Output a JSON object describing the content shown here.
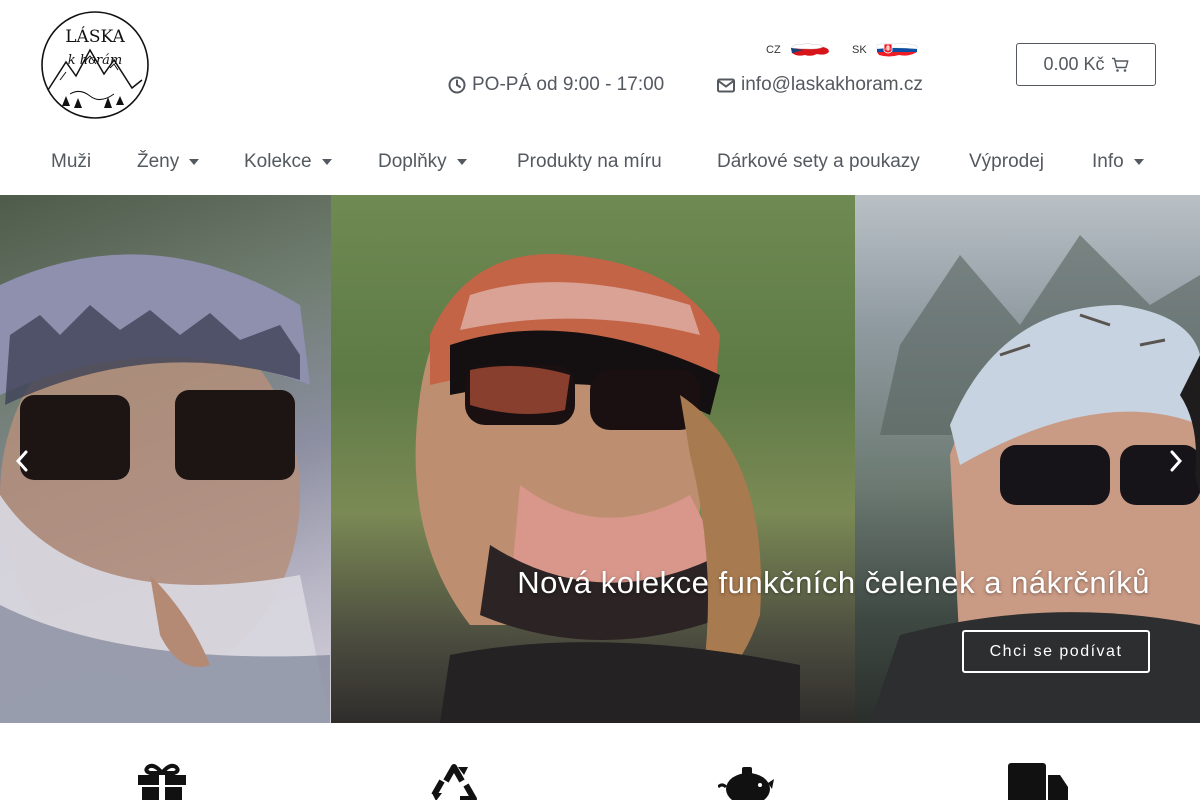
{
  "brand": {
    "name": "Láska k horám"
  },
  "languages": [
    {
      "code": "CZ"
    },
    {
      "code": "SK"
    }
  ],
  "contact": {
    "hours": "PO-PÁ od 9:00 - 17:00",
    "email": "info@laskakhoram.cz"
  },
  "cart": {
    "total": "0.00 Kč"
  },
  "nav": [
    {
      "label": "Muži",
      "dropdown": false
    },
    {
      "label": "Ženy",
      "dropdown": true
    },
    {
      "label": "Kolekce",
      "dropdown": true
    },
    {
      "label": "Doplňky",
      "dropdown": true
    },
    {
      "label": "Produkty na míru",
      "dropdown": false
    },
    {
      "label": "Dárkové sety a poukazy",
      "dropdown": false
    },
    {
      "label": "Výprodej",
      "dropdown": false
    },
    {
      "label": "Info",
      "dropdown": true
    }
  ],
  "hero": {
    "title": "Nová kolekce funkčních čelenek a nákrčníků",
    "button": "Chci se podívat",
    "prev_icon": "chevron-left-icon",
    "next_icon": "chevron-right-icon"
  },
  "features": [
    {
      "icon": "gift-icon"
    },
    {
      "icon": "recycle-icon"
    },
    {
      "icon": "piggy-bank-icon"
    },
    {
      "icon": "truck-icon"
    }
  ],
  "colors": {
    "text": "#54595f",
    "white": "#ffffff"
  }
}
